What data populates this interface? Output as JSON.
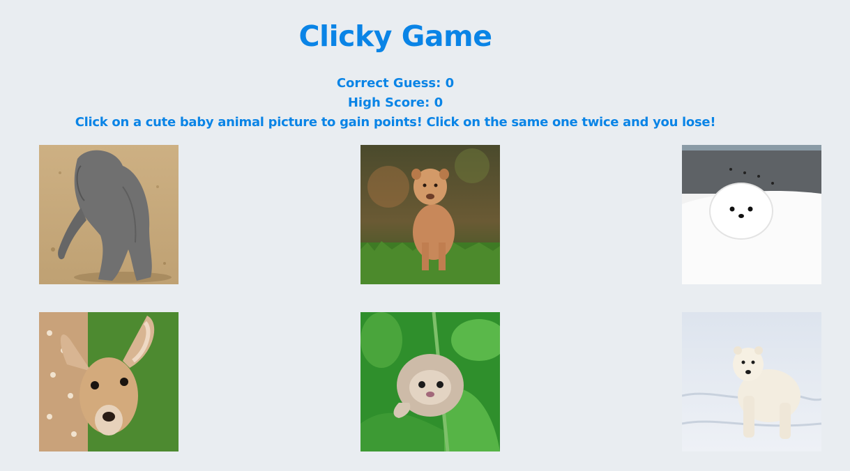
{
  "header": {
    "title": "Clicky Game",
    "correct_guess": "Correct Guess: 0",
    "high_score": "High Score: 0",
    "instructions": "Click on a cute baby animal picture to gain points! Click on the same one twice and you lose!"
  },
  "theme": {
    "accent": "#0a84e6",
    "background": "#e9edf1"
  },
  "cards": [
    {
      "animal": "baby elephant"
    },
    {
      "animal": "lion cub"
    },
    {
      "animal": "white puppy"
    },
    {
      "animal": "fawn"
    },
    {
      "animal": "baby sloth"
    },
    {
      "animal": "polar bear cub"
    }
  ]
}
